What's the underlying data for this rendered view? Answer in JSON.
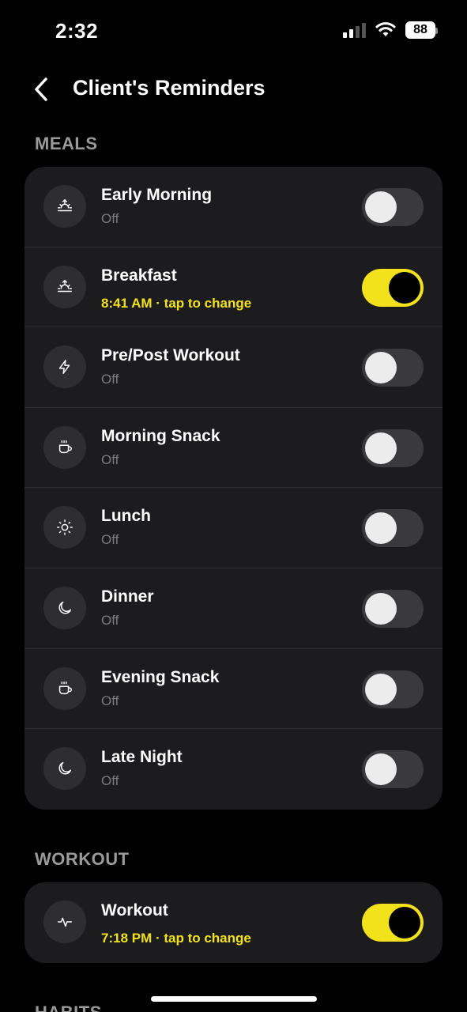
{
  "status": {
    "time": "2:32",
    "battery": "88"
  },
  "header": {
    "title": "Client's Reminders"
  },
  "sections": {
    "meals": {
      "title": "MEALS",
      "items": [
        {
          "title": "Early Morning",
          "subtitle": "Off",
          "on": false,
          "icon": "sunrise-icon"
        },
        {
          "title": "Breakfast",
          "subtitle": "8:41 AM · tap to change",
          "on": true,
          "icon": "sunrise-icon"
        },
        {
          "title": "Pre/Post Workout",
          "subtitle": "Off",
          "on": false,
          "icon": "lightning-icon"
        },
        {
          "title": "Morning Snack",
          "subtitle": "Off",
          "on": false,
          "icon": "coffee-cup-icon"
        },
        {
          "title": "Lunch",
          "subtitle": "Off",
          "on": false,
          "icon": "sun-icon"
        },
        {
          "title": "Dinner",
          "subtitle": "Off",
          "on": false,
          "icon": "moon-icon"
        },
        {
          "title": "Evening Snack",
          "subtitle": "Off",
          "on": false,
          "icon": "coffee-cup-icon"
        },
        {
          "title": "Late Night",
          "subtitle": "Off",
          "on": false,
          "icon": "moon-icon"
        }
      ]
    },
    "workout": {
      "title": "WORKOUT",
      "items": [
        {
          "title": "Workout",
          "subtitle": "7:18 PM · tap to change",
          "on": true,
          "icon": "activity-icon"
        }
      ]
    },
    "habits": {
      "title": "HABITS"
    }
  },
  "colors": {
    "accent": "#f2e21c",
    "card": "#1c1c1e",
    "background": "#000000"
  }
}
